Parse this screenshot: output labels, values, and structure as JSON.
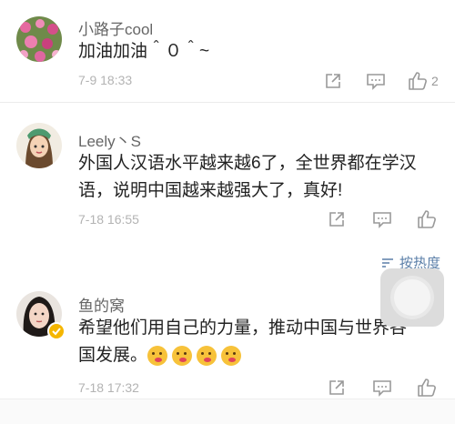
{
  "comments": [
    {
      "username": "小路子cool",
      "text": "加油加油＾０＾~",
      "time": "7-9 18:33",
      "likes": "2",
      "avatar": "flower-field-avatar"
    },
    {
      "username": "Leely丶S",
      "text_line1": "外国人汉语水平越来越6了，全世界都在学汉",
      "text_line2": "语，说明中国越来越强大了，真好!",
      "time": "7-18 16:55",
      "likes": "",
      "avatar": "girl-illustration-avatar"
    },
    {
      "username": "鱼的窝",
      "text_line1": "希望他们用自己的力量，推动中国与世界各",
      "text_line2": "国发展。",
      "emoji_count": 4,
      "time": "7-18 17:32",
      "likes": "",
      "avatar": "woman-photo-avatar",
      "verified": true
    }
  ],
  "sort_label": "按热度",
  "colors": {
    "accent": "#5b7fa8",
    "verified": "#f5b600",
    "meta": "#b3b3b3"
  }
}
